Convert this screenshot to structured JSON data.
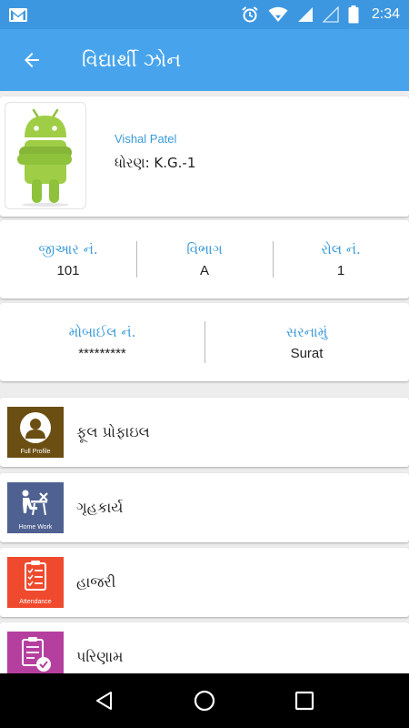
{
  "status_bar": {
    "time": "2:34",
    "icons": [
      "gmail-icon",
      "alarm-icon",
      "wifi-icon",
      "signal-icon",
      "signal-empty-icon",
      "battery-icon"
    ]
  },
  "app_bar": {
    "title": "વિદ્યાર્થી ઝોન",
    "back_icon": "arrow-left-icon"
  },
  "profile": {
    "name": "Vishal Patel",
    "class_label": "ધોરણ:",
    "class_value": "K.G.-1"
  },
  "info_row_1": [
    {
      "label": "જીઆર નં.",
      "value": "101"
    },
    {
      "label": "વિભાગ",
      "value": "A"
    },
    {
      "label": "રોલ નં.",
      "value": "1"
    }
  ],
  "info_row_2": [
    {
      "label": "મોબાઈલ નં.",
      "value": "*********"
    },
    {
      "label": "સરનામું",
      "value": "Surat"
    }
  ],
  "menu": [
    {
      "label": "ફૂલ પ્રોફાઇલ",
      "icon_caption": "Full Profile",
      "icon": "person-icon",
      "color": "#6b4e12"
    },
    {
      "label": "ગૃહકાર્ય",
      "icon_caption": "Home Work",
      "icon": "homework-icon",
      "color": "#4f6190"
    },
    {
      "label": "હાજરી",
      "icon_caption": "Attendance",
      "icon": "clipboard-list-icon",
      "color": "#ef4a2d"
    },
    {
      "label": "પરિણામ",
      "icon_caption": "",
      "icon": "clipboard-check-icon",
      "color": "#b53f9f"
    }
  ],
  "nav_bar": {
    "icons": [
      "back-triangle-icon",
      "home-circle-icon",
      "recents-square-icon"
    ]
  },
  "colors": {
    "status_bar": "#3d97e0",
    "app_bar": "#47a4ec",
    "accent_text": "#3a9bd9"
  }
}
